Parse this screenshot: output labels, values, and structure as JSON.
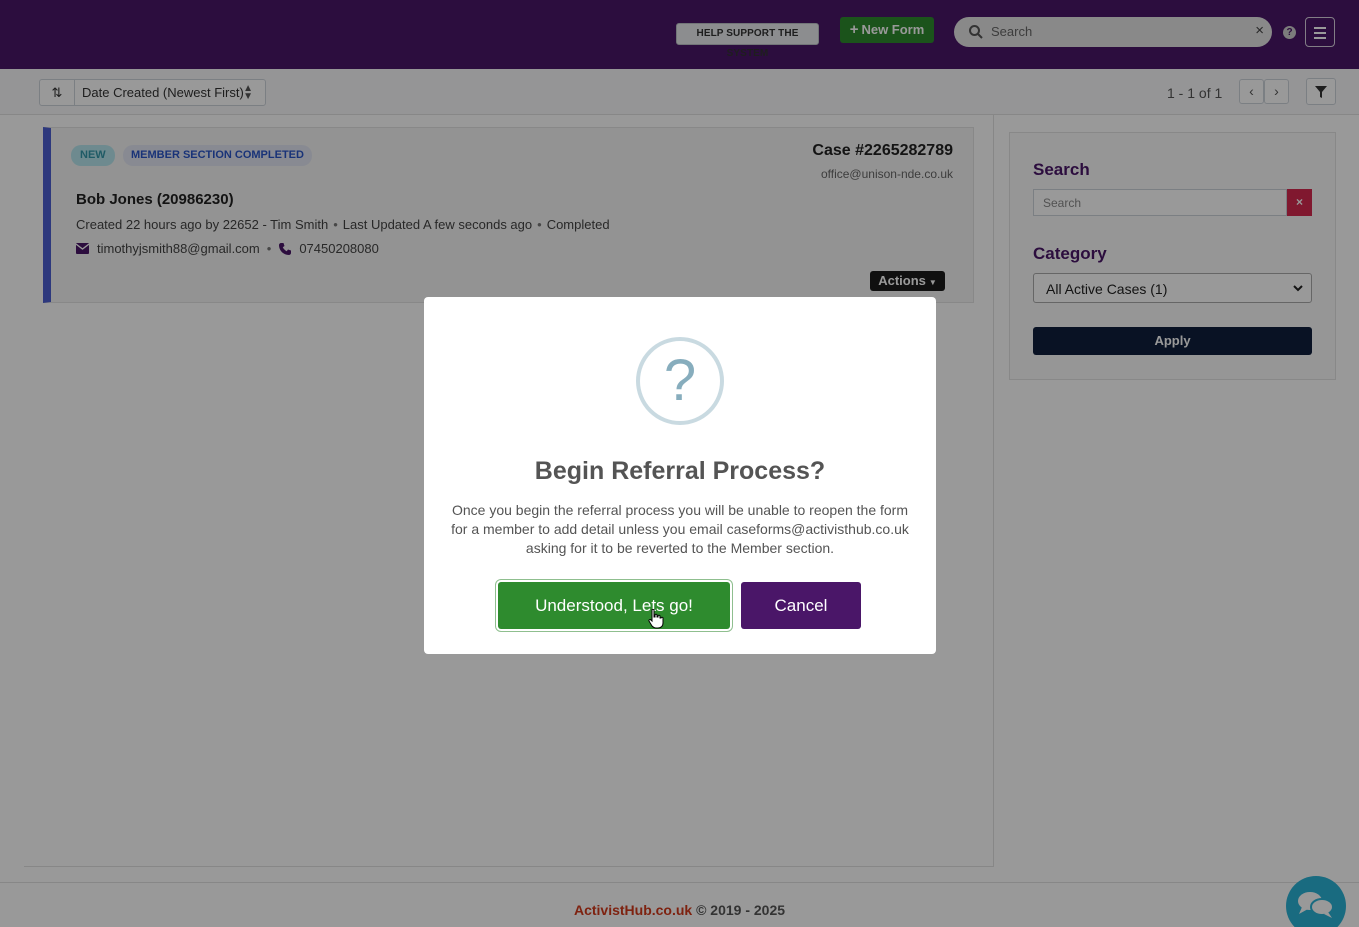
{
  "header": {
    "help_label": "HELP SUPPORT THE SYSTEM",
    "new_form_label": "New Form",
    "search_placeholder": "Search",
    "clear_glyph": "×",
    "help_icon_glyph": "?"
  },
  "sortbar": {
    "sort_label": "Date Created (Newest First)",
    "pagination": "1 - 1 of 1",
    "prev_glyph": "‹",
    "next_glyph": "›"
  },
  "case": {
    "badge_status": "NEW",
    "badge_section": "MEMBER SECTION COMPLETED",
    "case_number": "Case #2265282789",
    "office_email": "office@unison-nde.co.uk",
    "member_name": "Bob Jones (20986230)",
    "created": "Created 22 hours ago by 22652 - Tim Smith",
    "updated": "Last Updated A few seconds ago",
    "status": "Completed",
    "email": "timothyjsmith88@gmail.com",
    "phone": "07450208080",
    "actions_label": "Actions"
  },
  "sidebar": {
    "search_heading": "Search",
    "search_placeholder": "Search",
    "clear_glyph": "×",
    "category_heading": "Category",
    "category_value": "All Active Cases (1)",
    "apply_label": "Apply"
  },
  "footer": {
    "brand": "ActivistHub.co.uk",
    "copyright": "© 2019 - 2025"
  },
  "modal": {
    "icon_glyph": "?",
    "title": "Begin Referral Process?",
    "body": "Once you begin the referral process you will be unable to reopen the form for a member to add detail unless you email caseforms@activisthub.co.uk asking for it to be reverted to the Member section.",
    "confirm_label": "Understood, Lets go!",
    "cancel_label": "Cancel"
  },
  "colors": {
    "brand_purple": "#4a1668",
    "success_green": "#2e8b2e",
    "accent_blue": "#4c5ed1",
    "danger_red": "#d6294f",
    "chat_cyan": "#2bb3d6"
  }
}
